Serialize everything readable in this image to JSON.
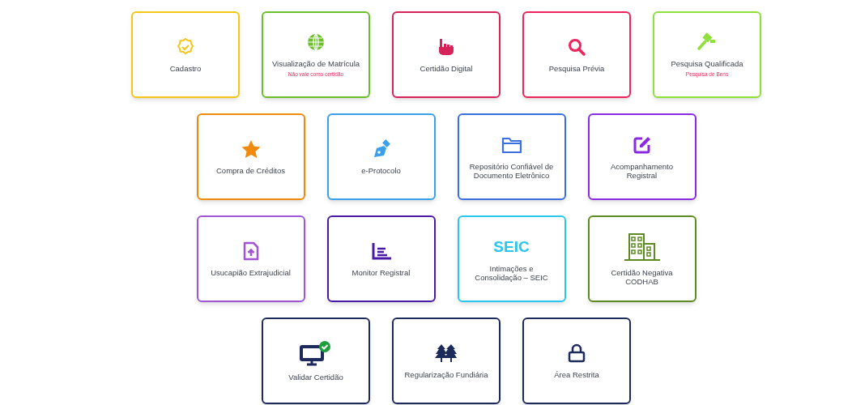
{
  "rows": [
    {
      "cards": [
        {
          "label": "Cadastro",
          "color": "#f5c518"
        },
        {
          "label": "Visualização de Matrícula",
          "note": "Não vale como certidão",
          "color": "#6cbf2a"
        },
        {
          "label": "Certidão Digital",
          "color": "#d6245a"
        },
        {
          "label": "Pesquisa Prévia",
          "color": "#f0245c"
        },
        {
          "label": "Pesquisa Qualificada",
          "note": "Pesquisa de Bens",
          "color": "#8fe03a"
        }
      ]
    },
    {
      "cards": [
        {
          "label": "Compra de Créditos",
          "color": "#f08a0c"
        },
        {
          "label": "e-Protocolo",
          "color": "#3aa0ea"
        },
        {
          "label": "Repositório Confiável de Documento Eletrônico",
          "color": "#3a6fe0"
        },
        {
          "label": "Acompanhamento Registral",
          "color": "#8a2be2"
        }
      ]
    },
    {
      "cards": [
        {
          "label": "Usucapião Extrajudicial",
          "color": "#a055d6"
        },
        {
          "label": "Monitor Registral",
          "color": "#4a1aa6"
        },
        {
          "kind": "text-logo",
          "logo": "SEIC",
          "label": "Intimações e Consolidação – SEIC",
          "color": "#29c7ef"
        },
        {
          "label": "Certidão Negativa CODHAB",
          "color": "#5d8a22"
        }
      ]
    },
    {
      "cards": [
        {
          "label": "Validar Certidão",
          "color": "#1d2a5c"
        },
        {
          "label": "Regularização Fundiária",
          "color": "#1d2a5c"
        },
        {
          "label": "Área Restrita",
          "color": "#1d2a5c"
        }
      ]
    }
  ]
}
